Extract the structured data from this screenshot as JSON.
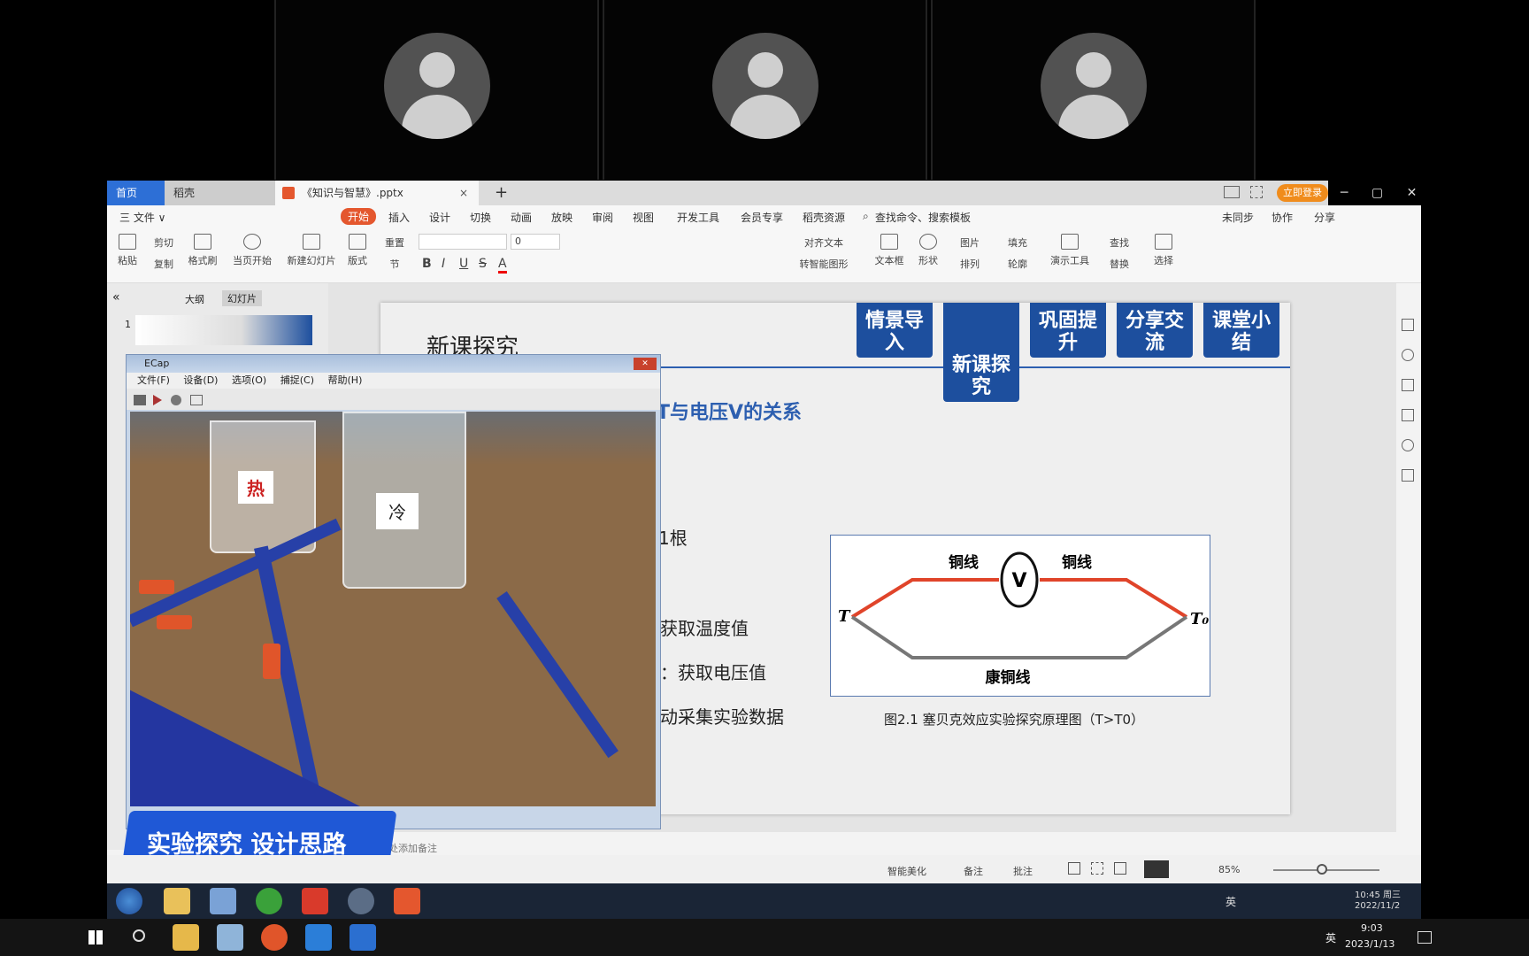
{
  "meeting": {
    "participants": [
      "participant-1",
      "participant-2",
      "participant-3"
    ]
  },
  "wps": {
    "tabs": {
      "home": "首页",
      "second": "稻壳",
      "doc": "《知识与智慧》.pptx",
      "add": "+"
    },
    "login_button": "立即登录",
    "menubar": {
      "file": "三 文件 ∨",
      "items": [
        "开始",
        "插入",
        "设计",
        "切换",
        "动画",
        "放映",
        "审阅",
        "视图",
        "开发工具",
        "会员专享",
        "稻壳资源"
      ],
      "search": "查找命令、搜索模板",
      "right": [
        "未同步",
        "协作",
        "分享"
      ]
    },
    "ribbon": {
      "paste": "粘贴",
      "cut": "剪切",
      "copy": "复制",
      "format_painter": "格式刷",
      "from_current": "当页开始",
      "new_slide": "新建幻灯片",
      "layout": "版式",
      "reset": "重置",
      "section": "节",
      "font_size": "0",
      "align_text": "对齐文本",
      "convert_smartart": "转智能图形",
      "textbox": "文本框",
      "shape": "形状",
      "picture": "图片",
      "arrange": "排列",
      "fill": "填充",
      "outline": "轮廓",
      "presenter": "演示工具",
      "find": "查找",
      "replace": "替换",
      "select": "选择"
    },
    "left_pane": {
      "collapse": "«",
      "outline_tab": "大纲",
      "slides_tab": "幻灯片",
      "slide_number": "1"
    },
    "slide": {
      "title": "新课探究",
      "nav": [
        "情景导入",
        "新课探究",
        "巩固提升",
        "分享交流",
        "课堂小结"
      ],
      "subtitle": "T与电压V的关系",
      "bullets": [
        "1根",
        "获取温度值",
        "：获取电压值",
        "动采集实验数据"
      ],
      "diagram": {
        "left_label": "铜线",
        "right_label": "铜线",
        "meter": "V",
        "bottom_label": "康铜线",
        "t_left": "T",
        "t_right": "T₀",
        "caption": "图2.1 塞贝克效应实验探究原理图（T>T0）"
      }
    },
    "notes_placeholder": "处添加备注",
    "status": {
      "beautify": "智能美化",
      "notes": "备注",
      "comments": "批注",
      "zoom": "85%",
      "zoom_level": 0.6
    }
  },
  "ecap": {
    "title": "ECap",
    "menu": [
      "文件(F)",
      "设备(D)",
      "选项(O)",
      "捕捉(C)",
      "帮助(H)"
    ],
    "label_hot": "热",
    "label_cold": "冷"
  },
  "banner": {
    "text": "实验探究 设计思路"
  },
  "inner_taskbar": {
    "time": "10:45 周三",
    "date": "2022/11/2",
    "lang": "英"
  },
  "win_taskbar": {
    "time": "9:03",
    "date": "2023/1/13",
    "lang": "英"
  },
  "colors": {
    "accent_blue": "#1d4f9e",
    "wps_blue": "#2d6fd6",
    "wire_red": "#e0442a"
  }
}
